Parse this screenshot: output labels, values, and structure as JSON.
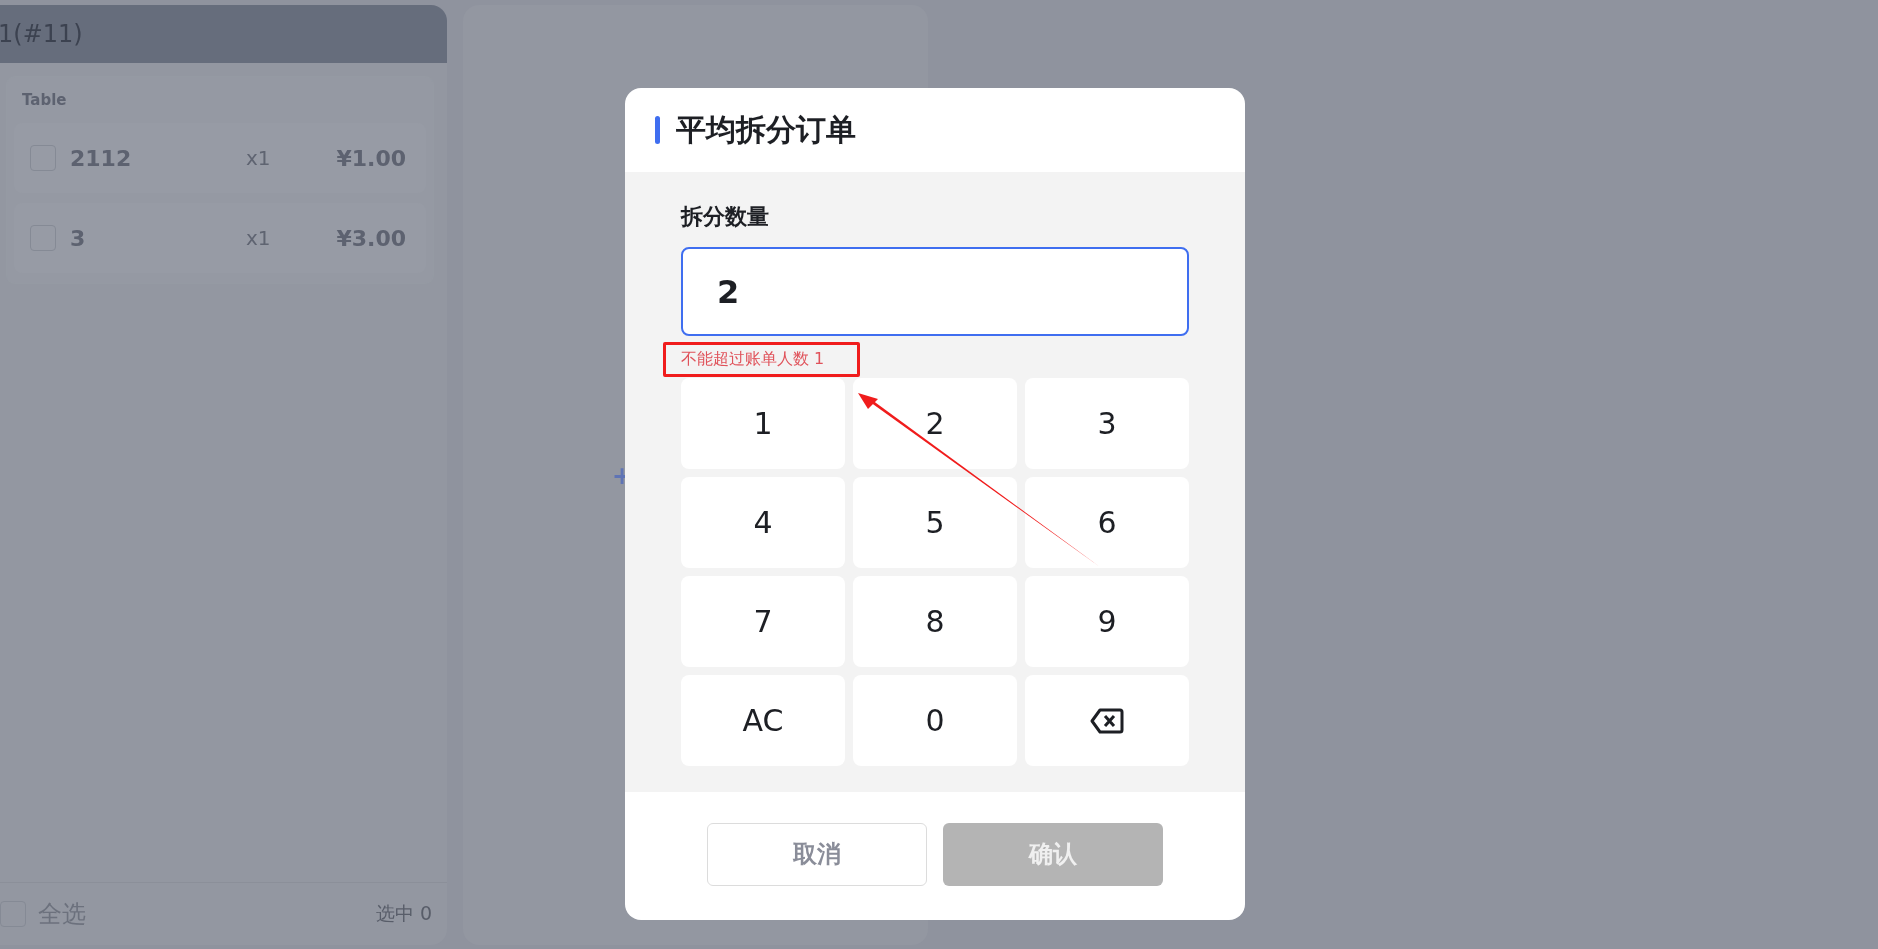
{
  "order_panel": {
    "title": "1(#11)",
    "group_label": "Table",
    "items": [
      {
        "name": "2112",
        "quantity": "x1",
        "price": "¥1.00",
        "checked": false
      },
      {
        "name": "3",
        "quantity": "x1",
        "price": "¥3.00",
        "checked": false
      }
    ],
    "select_all": {
      "label": "全选",
      "checked": false
    },
    "selected_count": "选中 0"
  },
  "add_symbol": "+",
  "dialog": {
    "title": "平均拆分订单",
    "field_label": "拆分数量",
    "value": "2",
    "error": "不能超过账单人数 1",
    "keys": [
      {
        "kind": "text",
        "label": "1"
      },
      {
        "kind": "text",
        "label": "2"
      },
      {
        "kind": "text",
        "label": "3"
      },
      {
        "kind": "text",
        "label": "4"
      },
      {
        "kind": "text",
        "label": "5"
      },
      {
        "kind": "text",
        "label": "6"
      },
      {
        "kind": "text",
        "label": "7"
      },
      {
        "kind": "text",
        "label": "8"
      },
      {
        "kind": "text",
        "label": "9"
      },
      {
        "kind": "text",
        "label": "AC"
      },
      {
        "kind": "text",
        "label": "0"
      },
      {
        "kind": "backspace"
      }
    ],
    "buttons": [
      {
        "label": "取消",
        "disabled": false
      },
      {
        "label": "确认",
        "disabled": true
      }
    ]
  }
}
